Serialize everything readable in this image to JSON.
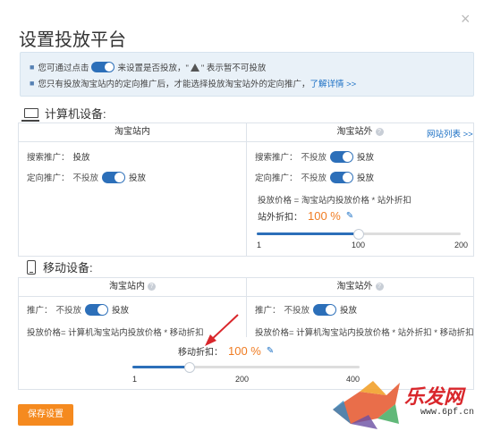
{
  "dialog": {
    "title": "设置投放平台",
    "close_glyph": "×"
  },
  "tips": {
    "bullet": "■",
    "line1_before": "您可通过点击",
    "line1_after": "来设置是否投放，\"",
    "line1_end": "\" 表示暂不可投放",
    "line2_text": "您只有投放淘宝站内的定向推广后，才能选择投放淘宝站外的定向推广，",
    "line2_link": "了解详情 >>"
  },
  "computer": {
    "heading": "计算机设备:",
    "inner": {
      "title": "淘宝站内",
      "search_label": "搜索推广：",
      "search_value": "投放",
      "target_label": "定向推广：",
      "target_off": "不投放",
      "target_on": "投放"
    },
    "outer": {
      "title": "淘宝站外",
      "site_list_link": "网站列表 >>",
      "search_label": "搜索推广：",
      "search_off": "不投放",
      "search_on": "投放",
      "target_label": "定向推广：",
      "target_off": "不投放",
      "target_on": "投放",
      "formula": "投放价格 = 淘宝站内投放价格 * 站外折扣",
      "discount_label": "站外折扣：",
      "discount_value": "100 %",
      "slider": {
        "min": "1",
        "mid": "100",
        "max": "200",
        "value_fraction": 0.5
      }
    }
  },
  "mobile": {
    "heading": "移动设备:",
    "inner": {
      "title": "淘宝站内",
      "promo_label": "推广：",
      "promo_off": "不投放",
      "promo_on": "投放",
      "formula": "投放价格= 计算机淘宝站内投放价格 * 移动折扣"
    },
    "outer": {
      "title": "淘宝站外",
      "promo_label": "推广：",
      "promo_off": "不投放",
      "promo_on": "投放",
      "formula": "投放价格= 计算机淘宝站内投放价格 * 站外折扣 * 移动折扣"
    },
    "discount_label": "移动折扣：",
    "discount_value": "100 %",
    "slider": {
      "min": "1",
      "mid": "200",
      "max": "400",
      "value_fraction": 0.25
    }
  },
  "footer": {
    "save_label": "保存设置"
  },
  "watermark": {
    "text": "乐发网",
    "url": "www.6pf.cn"
  },
  "colors": {
    "accent_blue": "#2c6fb9",
    "orange": "#f58a1f",
    "tips_bg": "#e9f1f8",
    "arrow_red": "#d9262b"
  },
  "icons": [
    "close-icon",
    "computer-icon",
    "mobile-phone-icon",
    "help-icon",
    "edit-pencil-icon",
    "warning-icon"
  ]
}
